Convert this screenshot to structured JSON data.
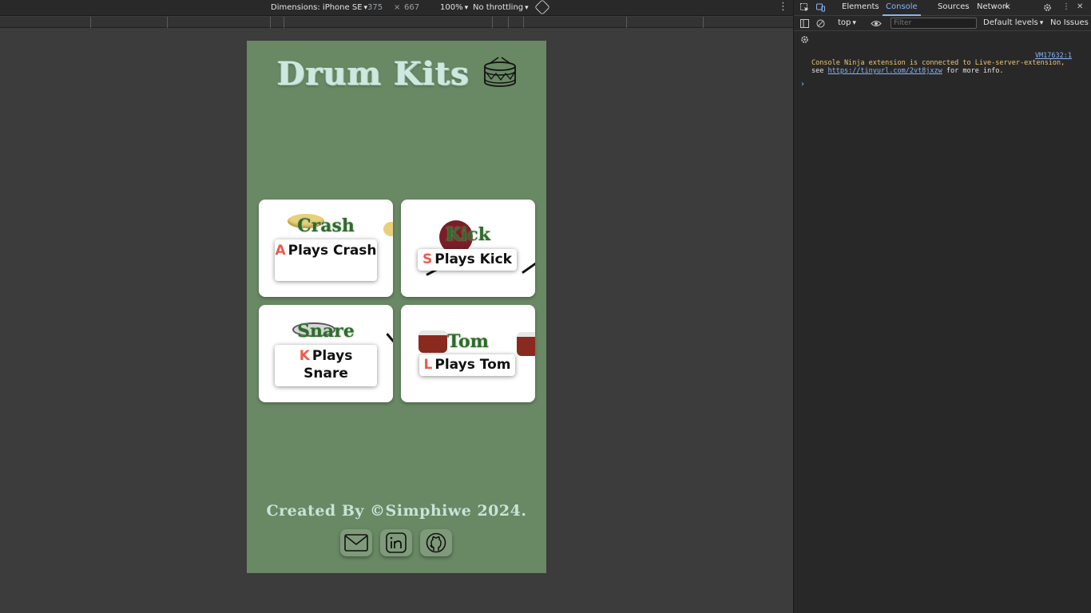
{
  "device_toolbar": {
    "dimensions_label": "Dimensions: iPhone SE",
    "width": "375",
    "times": "×",
    "height": "667",
    "zoom": "100%",
    "throttling": "No throttling"
  },
  "app": {
    "title": "Drum Kits",
    "cards": [
      {
        "name": "Crash",
        "key": "A",
        "label": "Plays Crash"
      },
      {
        "name": "Kick",
        "key": "S",
        "label": "Plays Kick"
      },
      {
        "name": "Snare",
        "key": "K",
        "label": "Plays Snare"
      },
      {
        "name": "Tom",
        "key": "L",
        "label": "Plays Tom"
      }
    ],
    "footer": "Created By ©Simphiwe 2024.",
    "socials": [
      "mail-icon",
      "linkedin-icon",
      "github-icon"
    ]
  },
  "devtools": {
    "tabs": [
      "Elements",
      "Console",
      "Sources",
      "Network"
    ],
    "active_tab": "Console",
    "context": "top",
    "filter_placeholder": "Filter",
    "levels": "Default levels",
    "issues": "No Issues",
    "console": {
      "source": "VM17632:1",
      "line1": "Console Ninja extension is connected to Live-server-extension,",
      "line2_prefix": "see ",
      "link": "https://tinyurl.com/2vt8jxzw",
      "line2_suffix": " for more info."
    }
  },
  "colors": {
    "page_bg": "#698864",
    "title": "#cde8de",
    "card_name": "#2f6b2c",
    "key": "#f05a4a",
    "accent": "#8ab4f8"
  }
}
